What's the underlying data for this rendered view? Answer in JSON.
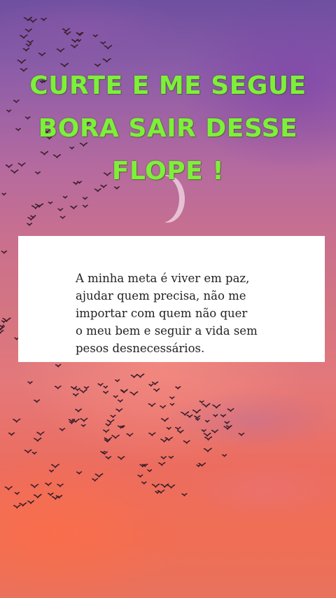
{
  "background": {
    "description_icon": "sunset-sky-with-birds-and-moon",
    "sky_colors": [
      "#6e4fa0",
      "#c9708e",
      "#f06e54"
    ]
  },
  "headline": {
    "color": "#7df03a",
    "lines": [
      "CURTE E ME SEGUE",
      "BORA SAIR DESSE",
      "FLOPE !"
    ]
  },
  "card": {
    "quote_lines": [
      "A minha meta é viver em paz,",
      "ajudar quem precisa, não me",
      "importar com quem não quer",
      "o meu bem e seguir a vida sem",
      "pesos desnecessários."
    ]
  }
}
